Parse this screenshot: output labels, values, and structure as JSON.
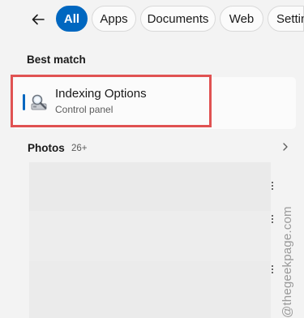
{
  "header": {
    "back_icon": "arrow-left-icon",
    "filters": [
      {
        "label": "All",
        "active": true
      },
      {
        "label": "Apps",
        "active": false
      },
      {
        "label": "Documents",
        "active": false
      },
      {
        "label": "Web",
        "active": false
      },
      {
        "label": "Settin",
        "active": false
      }
    ]
  },
  "best_match": {
    "heading": "Best match",
    "result": {
      "title": "Indexing Options",
      "subtitle": "Control panel",
      "icon": "indexing-options-icon"
    }
  },
  "photos": {
    "heading": "Photos",
    "count": "26+",
    "expand_icon": "chevron-right-icon",
    "item_count": 3
  },
  "watermark": "@thegeekpage.com",
  "colors": {
    "accent": "#0067c0",
    "highlight": "#e05252",
    "background": "#f3f3f3",
    "card": "#fbfbfb"
  }
}
